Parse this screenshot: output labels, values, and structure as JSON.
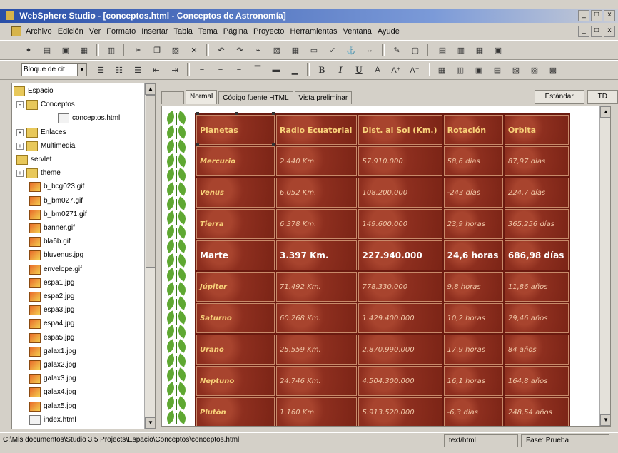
{
  "window": {
    "title": "WebSphere Studio - [conceptos.html - Conceptos de Astronomía]",
    "buttons": [
      "_",
      "□",
      "x"
    ]
  },
  "menu": [
    "Archivo",
    "Edición",
    "Ver",
    "Formato",
    "Insertar",
    "Tabla",
    "Tema",
    "Página",
    "Proyecto",
    "Herramientas",
    "Ventana",
    "Ayude"
  ],
  "format_toolbar": {
    "style_select": "Bloque de cit"
  },
  "tree": {
    "items": [
      {
        "label": "Espacio",
        "type": "root"
      },
      {
        "label": "Conceptos",
        "type": "folder",
        "expander": "-"
      },
      {
        "label": "conceptos.html",
        "type": "html"
      },
      {
        "label": "Enlaces",
        "type": "folder",
        "expander": "+"
      },
      {
        "label": "Multimedia",
        "type": "folder",
        "expander": "+"
      },
      {
        "label": "servlet",
        "type": "folder"
      },
      {
        "label": "theme",
        "type": "folder",
        "expander": "+"
      },
      {
        "label": "b_bcg023.gif",
        "type": "img"
      },
      {
        "label": "b_bm027.gif",
        "type": "img"
      },
      {
        "label": "b_bm0271.gif",
        "type": "img"
      },
      {
        "label": "banner.gif",
        "type": "img"
      },
      {
        "label": "bla6b.gif",
        "type": "img"
      },
      {
        "label": "bluvenus.jpg",
        "type": "img"
      },
      {
        "label": "envelope.gif",
        "type": "img"
      },
      {
        "label": "espa1.jpg",
        "type": "img"
      },
      {
        "label": "espa2.jpg",
        "type": "img"
      },
      {
        "label": "espa3.jpg",
        "type": "img"
      },
      {
        "label": "espa4.jpg",
        "type": "img"
      },
      {
        "label": "espa5.jpg",
        "type": "img"
      },
      {
        "label": "galax1.jpg",
        "type": "img"
      },
      {
        "label": "galax2.jpg",
        "type": "img"
      },
      {
        "label": "galax3.jpg",
        "type": "img"
      },
      {
        "label": "galax4.jpg",
        "type": "img"
      },
      {
        "label": "galax5.jpg",
        "type": "img"
      },
      {
        "label": "index.html",
        "type": "html"
      }
    ]
  },
  "tabs": [
    "Normal",
    "Código fuente HTML",
    "Vista preliminar"
  ],
  "tab_panel": [
    "Estándar",
    "TD"
  ],
  "table": {
    "headers": [
      "Planetas",
      "Radio Ecuatorial",
      "Dist. al Sol (Km.)",
      "Rotación",
      "Orbita"
    ],
    "rows": [
      [
        "Mercurio",
        "2.440 Km.",
        "57.910.000",
        "58,6 días",
        "87,97 días"
      ],
      [
        "Venus",
        "6.052 Km.",
        "108.200.000",
        "-243 días",
        "224,7 días"
      ],
      [
        "Tierra",
        "6.378 Km.",
        "149.600.000",
        "23,9 horas",
        "365,256 días"
      ],
      [
        "Marte",
        "3.397 Km.",
        "227.940.000",
        "24,6 horas",
        "686,98 días"
      ],
      [
        "Júpiter",
        "71.492 Km.",
        "778.330.000",
        "9,8 horas",
        "11,86 años"
      ],
      [
        "Saturno",
        "60.268 Km.",
        "1.429.400.000",
        "10,2 horas",
        "29,46 años"
      ],
      [
        "Urano",
        "25.559 Km.",
        "2.870.990.000",
        "17,9 horas",
        "84 años"
      ],
      [
        "Neptuno",
        "24.746 Km.",
        "4.504.300.000",
        "16,1 horas",
        "164,8 años"
      ],
      [
        "Plutón",
        "1.160 Km.",
        "5.913.520.000",
        "-6,3 días",
        "248,54 años"
      ]
    ]
  },
  "statusbar": {
    "path": "C:\\Mis documentos\\Studio 3.5 Projects\\Espacio\\Conceptos\\conceptos.html",
    "mime": "text/html",
    "fase": "Fase: Prueba"
  }
}
